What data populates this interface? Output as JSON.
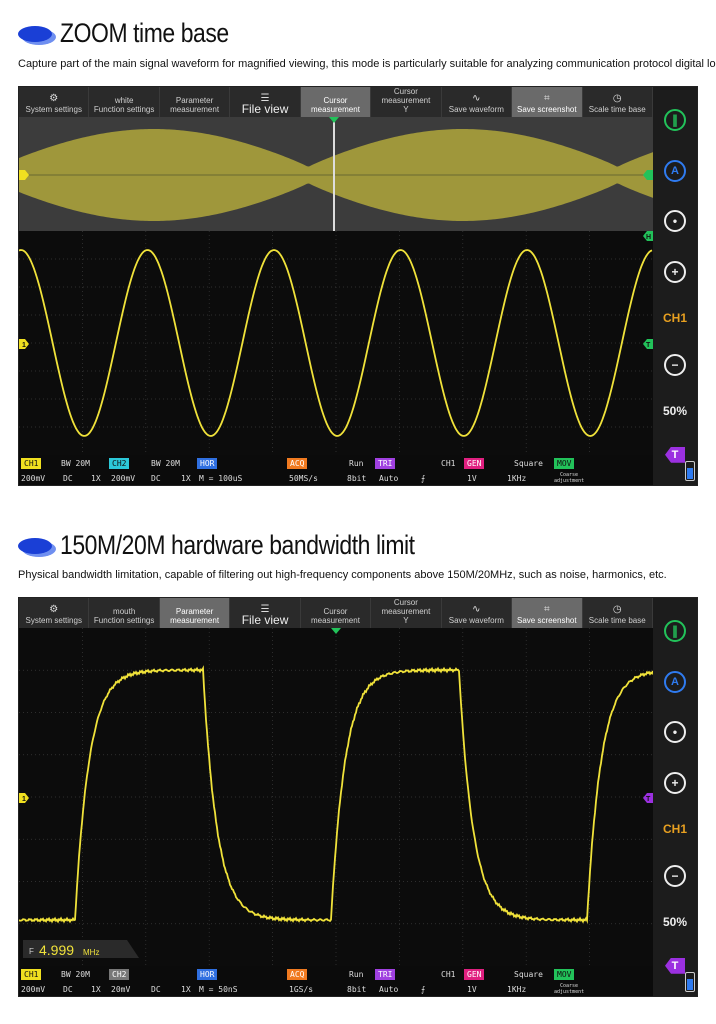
{
  "section1": {
    "title": "ZOOM time base",
    "subtitle": "Capture part of the main signal waveform for magnified viewing, this mode is particularly suitable for analyzing communication protocol digital logic signal"
  },
  "section2": {
    "title": "150M/20M hardware bandwidth limit",
    "subtitle": "Physical bandwidth limitation, capable of filtering out high-frequency components above 150M/20MHz, such as noise, harmonics, etc."
  },
  "scope1": {
    "toolbar": [
      {
        "label": "System settings",
        "icon": "gear-icon",
        "glyph": "⚙",
        "active": false
      },
      {
        "label": "Function settings",
        "top": "white",
        "icon": "function-icon",
        "glyph": "",
        "active": false
      },
      {
        "label": "Parameter measurement",
        "icon": "parameter-icon",
        "glyph": "",
        "active": false
      },
      {
        "label": "File view",
        "icon": "database-icon",
        "glyph": "☰",
        "active": false,
        "big": true
      },
      {
        "label": "Cursor measurement",
        "icon": "cursor-icon",
        "glyph": "",
        "active": true
      },
      {
        "label": "Cursor measurement",
        "sub": "Y",
        "icon": "cursor-y-icon",
        "glyph": "",
        "active": false
      },
      {
        "label": "Save waveform",
        "icon": "save-waveform-icon",
        "glyph": "∿",
        "active": false
      },
      {
        "label": "Save screenshot",
        "icon": "crop-icon",
        "glyph": "⌗",
        "active": true
      },
      {
        "label": "Scale time base",
        "icon": "clock-icon",
        "glyph": "◷",
        "active": false
      }
    ],
    "sidebar": {
      "ch": "CH1",
      "pct": "50%"
    },
    "status": {
      "ch1": "CH1",
      "bw1": "BW 20M",
      "ch2": "CH2",
      "bw2": "BW 20M",
      "hor": "HOR",
      "acq": "ACQ",
      "run": "Run",
      "tri": "TRI",
      "trich": "CH1",
      "gen": "GEN",
      "wave": "Square",
      "mov": "MOV",
      "v1": "200mV",
      "c1": "DC",
      "x1": "1X",
      "v2": "200mV",
      "c2": "DC",
      "x2": "1X",
      "timebase": "M = 100uS",
      "rate": "50MS/s",
      "bits": "8bit",
      "mode": "Auto",
      "edge": "⨍",
      "amp": "1V",
      "freq": "1KHz",
      "adj": "Coarse adjustment"
    }
  },
  "scope2": {
    "toolbar": [
      {
        "label": "System settings",
        "icon": "gear-icon",
        "glyph": "⚙",
        "active": false
      },
      {
        "label": "Function settings",
        "top": "mouth",
        "icon": "function-icon",
        "glyph": "",
        "active": false
      },
      {
        "label": "Parameter measurement",
        "icon": "parameter-icon",
        "glyph": "",
        "active": true
      },
      {
        "label": "File view",
        "icon": "database-icon",
        "glyph": "☰",
        "active": false,
        "big": true
      },
      {
        "label": "Cursor measurement",
        "icon": "cursor-icon",
        "glyph": "",
        "active": false
      },
      {
        "label": "Cursor measurement",
        "sub": "Y",
        "icon": "cursor-y-icon",
        "glyph": "",
        "active": false
      },
      {
        "label": "Save waveform",
        "icon": "save-waveform-icon",
        "glyph": "∿",
        "active": false
      },
      {
        "label": "Save screenshot",
        "icon": "crop-icon",
        "glyph": "⌗",
        "active": true
      },
      {
        "label": "Scale time base",
        "icon": "clock-icon",
        "glyph": "◷",
        "active": false
      }
    ],
    "sidebar": {
      "ch": "CH1",
      "pct": "50%"
    },
    "freq_readout": {
      "prefix": "F",
      "value": "4.999",
      "unit": "MHz"
    },
    "status": {
      "ch1": "CH1",
      "bw1": "BW 20M",
      "ch2": "CH2",
      "bw2": "",
      "hor": "HOR",
      "acq": "ACQ",
      "run": "Run",
      "tri": "TRI",
      "trich": "CH1",
      "gen": "GEN",
      "wave": "Square",
      "mov": "MOV",
      "v1": "200mV",
      "c1": "DC",
      "x1": "1X",
      "v2": "20mV",
      "c2": "DC",
      "x2": "1X",
      "timebase": "M = 50nS",
      "rate": "1GS/s",
      "bits": "8bit",
      "mode": "Auto",
      "edge": "⨍",
      "amp": "1V",
      "freq": "1KHz",
      "adj": "Coarse adjustment"
    }
  },
  "colors": {
    "trace": "#f0e23a",
    "grid": "#3a3a3a",
    "marker_yellow": "#f0e020",
    "marker_green": "#22c25a",
    "marker_purple": "#9b30e0"
  }
}
